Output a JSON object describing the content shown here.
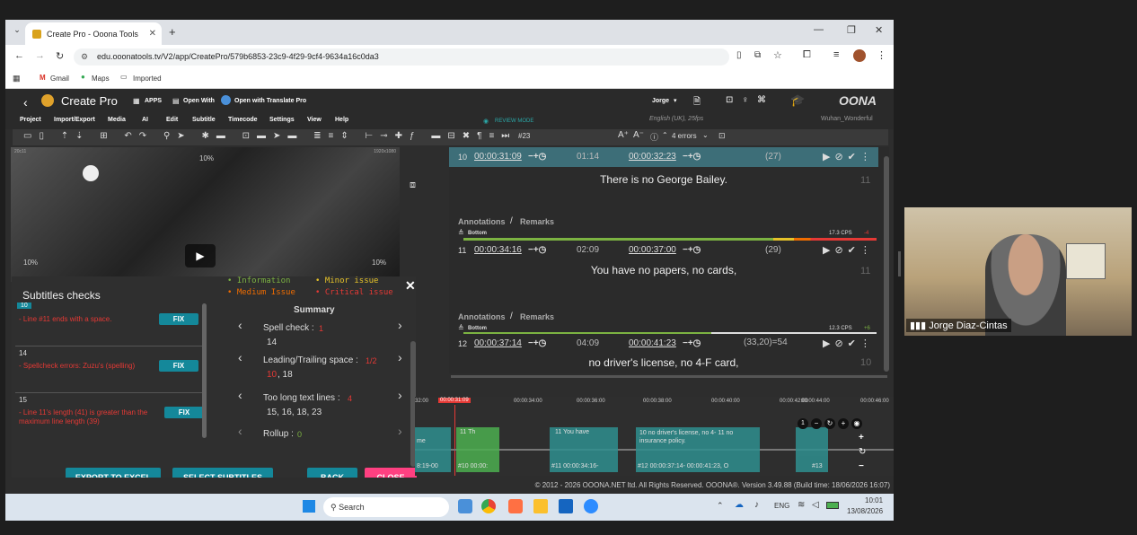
{
  "browser": {
    "tab_title": "Create Pro - Ooona Tools",
    "new_tab": "+",
    "url": "edu.ooonatools.tv/V2/app/CreatePro/579b6853-23c9-4f29-9cf4-9634a16c0da3",
    "bookmarks": [
      "Gmail",
      "Maps",
      "Imported"
    ]
  },
  "app": {
    "title": "Create Pro",
    "apps": "APPS",
    "open_with": "Open With",
    "open_translate": "Open with Translate Pro",
    "user": "Jorge",
    "language": "English (UK), 25fps",
    "project_name": "Wuhan_Wonderful",
    "review_mode": "REVIEW MODE",
    "logo": "OONA",
    "menu": [
      "Project",
      "Import/Export",
      "Media",
      "AI",
      "Edit",
      "Subtitle",
      "Timecode",
      "Settings",
      "View",
      "Help"
    ],
    "subtitle_number": "#23",
    "errors": "4 errors"
  },
  "video": {
    "tc_small": "20c11",
    "pct_top": "10%",
    "pct_left": "10%",
    "pct_right": "10%",
    "res": "1920x1080"
  },
  "checks": {
    "title": "Subtitles checks",
    "legend": {
      "information": "Information",
      "minor": "Minor issue",
      "medium": "Medium Issue",
      "critical": "Critical issue"
    },
    "items": [
      {
        "num": "10",
        "text": "- Line #11 ends with a space.",
        "fix": "FIX"
      },
      {
        "num": "14",
        "text": "- Spellcheck errors: Zuzu's (spelling)",
        "fix": "FIX"
      },
      {
        "num": "15",
        "text": "- Line 11's length (41) is greater than the maximum line length (39)",
        "fix": "FIX"
      }
    ],
    "summary_title": "Summary",
    "summary": [
      {
        "label": "Spell check :",
        "count": "1",
        "values": "14"
      },
      {
        "label": "Leading/Trailing space :",
        "count": "1/2",
        "values_red": "10",
        "values": ",  18"
      },
      {
        "label": "Too long text lines :",
        "count": "4",
        "values": "15,  16,  18,  23"
      },
      {
        "label": "Rollup :",
        "count": "0",
        "values": ""
      }
    ],
    "buttons": {
      "export": "EXPORT TO EXCEL",
      "select": "SELECT SUBTITLES",
      "back": "BACK",
      "close": "CLOSE"
    }
  },
  "subtitles": [
    {
      "num": "10",
      "in": "00:00:31:09",
      "dur": "01:14",
      "out": "00:00:32:23",
      "chars": "(27)",
      "text": "There is no George Bailey.",
      "remaining": "11",
      "position": "Bottom",
      "cps": "17.3 CPS",
      "cps_delta": "-4",
      "annotations": "Annotations",
      "remarks": "Remarks"
    },
    {
      "num": "11",
      "in": "00:00:34:16",
      "dur": "02:09",
      "out": "00:00:37:00",
      "chars": "(29)",
      "text": "You have no papers, no cards,",
      "remaining": "11",
      "position": "Bottom",
      "cps": "12.3 CPS",
      "cps_delta": "+6",
      "annotations": "Annotations",
      "remarks": "Remarks"
    },
    {
      "num": "12",
      "in": "00:00:37:14",
      "dur": "04:09",
      "out": "00:00:41:23",
      "chars": "(33,20)=54",
      "text": "no driver's license, no 4-F card,",
      "remaining": "10"
    }
  ],
  "timeline": {
    "ticks": [
      "32:00",
      "00:00:34:00",
      "00:00:36:00",
      "00:00:38:00",
      "00:00:40:00",
      "00:00:42:00",
      "00:00:44:00",
      "00:00:46:00"
    ],
    "playhead": "00:00:31:09",
    "clips": [
      {
        "label_top": "me",
        "label_bottom": "8:19-00"
      },
      {
        "label_top": "11 Th",
        "label_bottom": "#10 00:00:"
      },
      {
        "label_top": "11 You have",
        "label_bottom": "#11 00:00:34:16-"
      },
      {
        "label_top": "10  no driver's license, no 4-  11      no insurance policy.",
        "label_bottom": "#12 00:00:37:14- 00:00:41:23, O"
      },
      {
        "label_top": "",
        "label_bottom": "#13"
      }
    ],
    "zoom": "1"
  },
  "footer": "© 2012 - 2026  OOONA.NET ltd. All Rights Reserved. OOONA®. Version 3.49.88 (Build time: 18/06/2026 16:07)",
  "taskbar": {
    "search": "Search",
    "lang": "ENG",
    "time": "10:01",
    "date": "13/08/2026"
  },
  "camera": {
    "name": "Jorge Diaz-Cintas"
  }
}
